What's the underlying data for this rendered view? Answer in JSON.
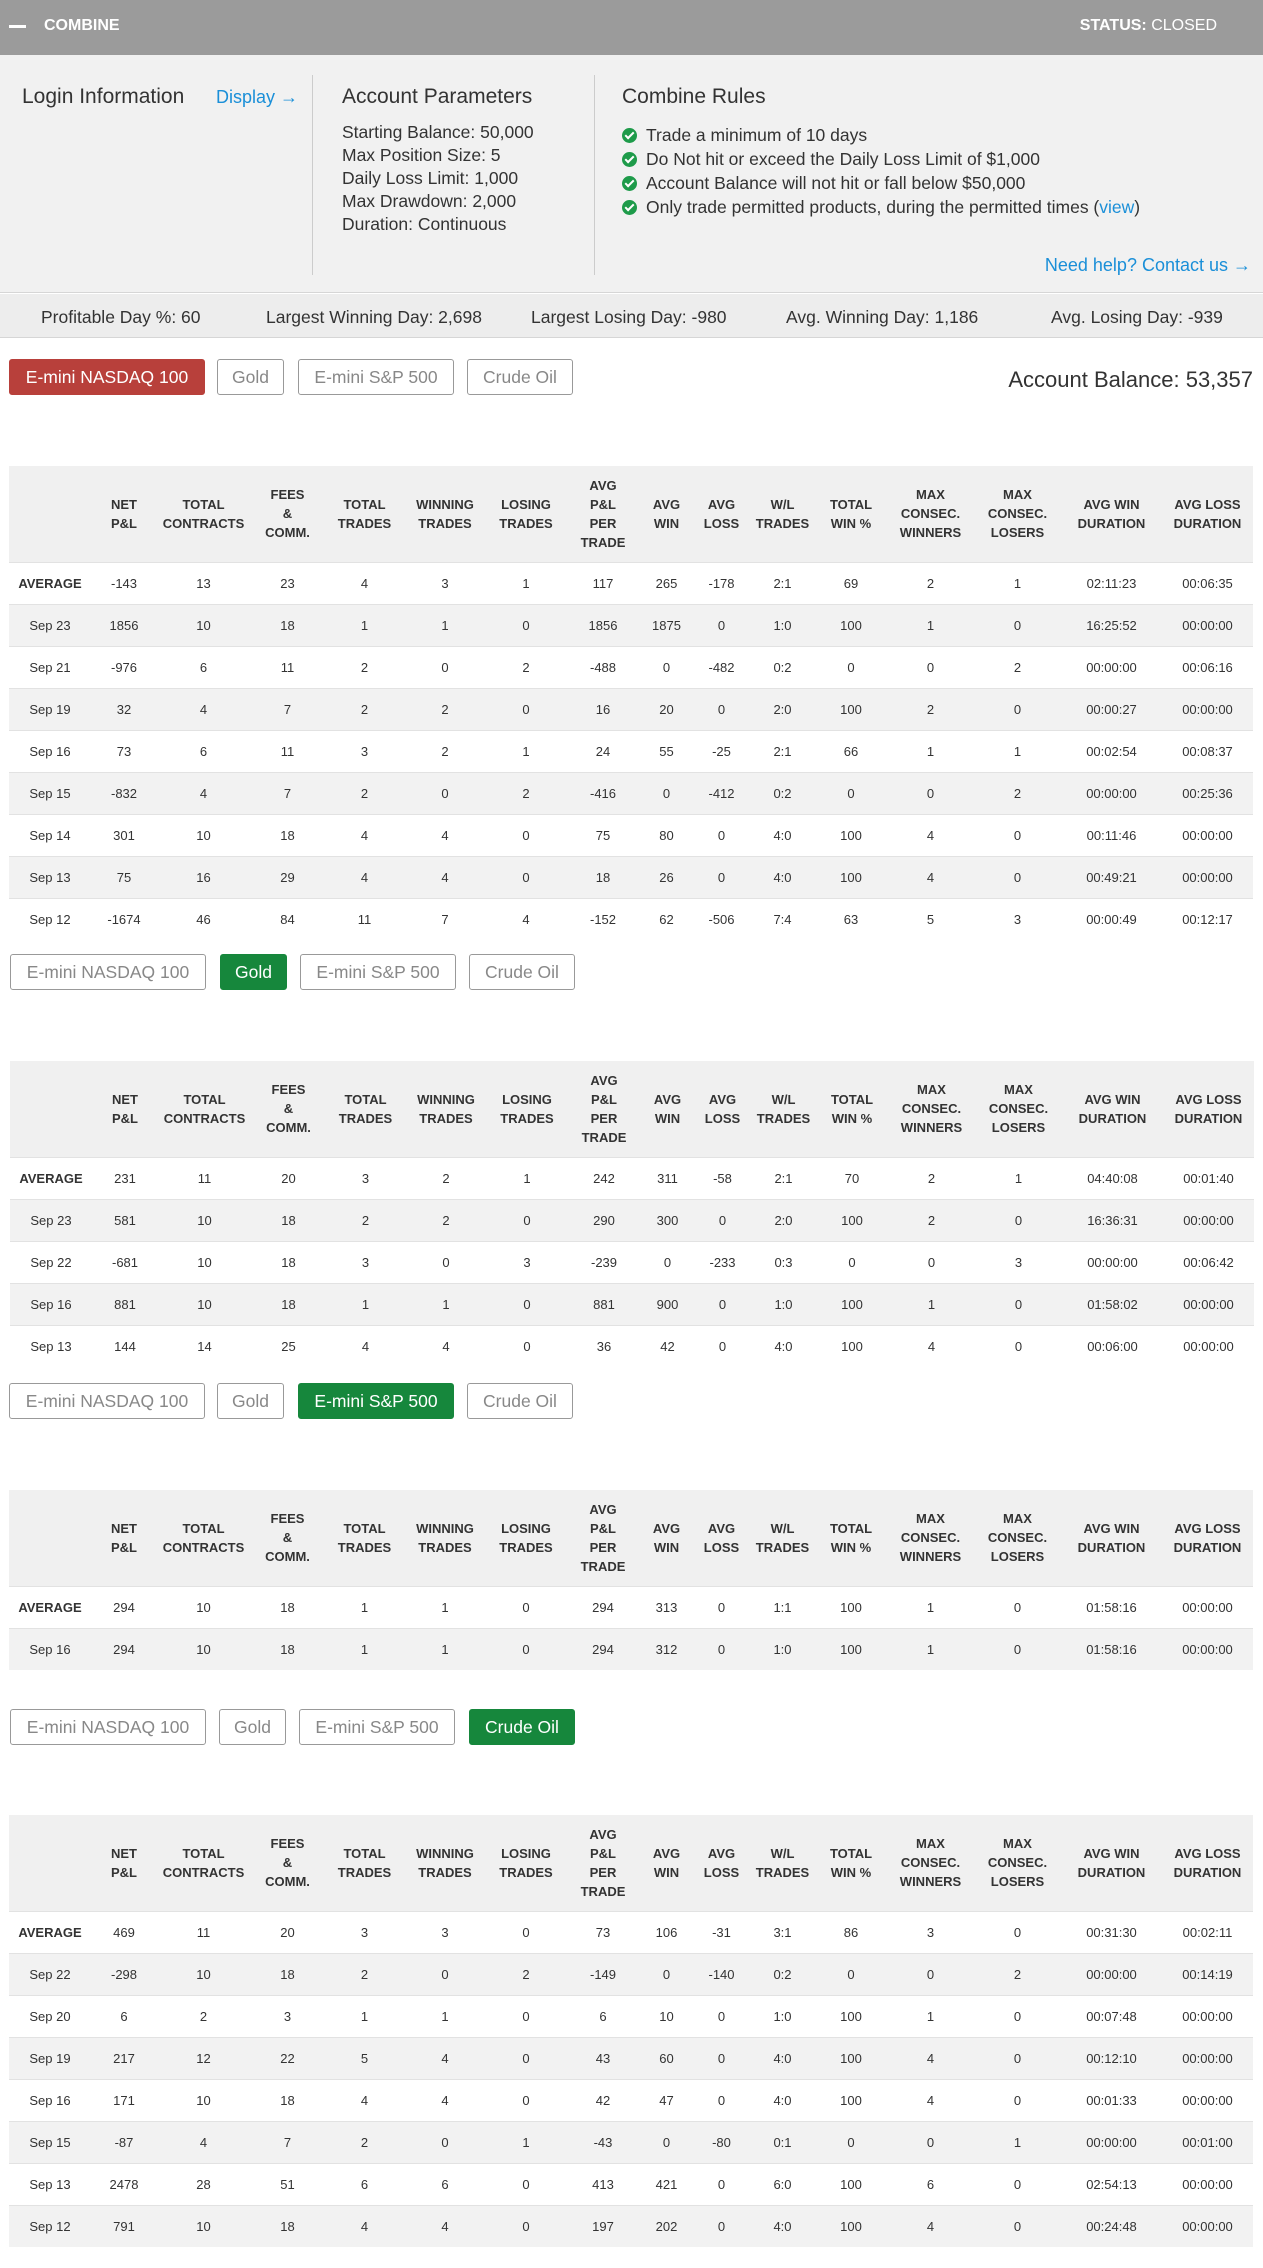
{
  "header": {
    "title": "COMBINE",
    "status_label": "STATUS:",
    "status_value": "CLOSED"
  },
  "login": {
    "title": "Login Information",
    "display_link": "Display →"
  },
  "params": {
    "title": "Account Parameters",
    "items": [
      "Starting Balance: 50,000",
      "Max Position Size: 5",
      "Daily Loss Limit: 1,000",
      "Max Drawdown: 2,000",
      "Duration: Continuous"
    ]
  },
  "rules": {
    "title": "Combine Rules",
    "items": [
      "Trade a minimum of 10 days",
      "Do Not hit or exceed the Daily Loss Limit of $1,000",
      "Account Balance will not hit or fall below $50,000",
      "Only trade permitted products, during the permitted times ("
    ],
    "view_link": "view",
    "close_paren": ")",
    "help_link": "Need help? Contact us →"
  },
  "stats": {
    "profitable": "Profitable Day %: 60",
    "largest_win": "Largest Winning Day: 2,698",
    "largest_loss": "Largest Losing Day: -980",
    "avg_win": "Avg. Winning Day: 1,186",
    "avg_loss": "Avg. Losing Day: -939"
  },
  "balance": "Account Balance: 53,357",
  "tab_labels": [
    "E-mini NASDAQ 100",
    "Gold",
    "E-mini S&P 500",
    "Crude Oil"
  ],
  "columns": [
    "",
    "NET P&L",
    "TOTAL CONTRACTS",
    "FEES & COMM.",
    "TOTAL TRADES",
    "WINNING TRADES",
    "LOSING TRADES",
    "AVG P&L PER TRADE",
    "AVG WIN",
    "AVG LOSS",
    "W/L TRADES",
    "TOTAL WIN %",
    "MAX CONSEC. WINNERS",
    "MAX CONSEC. LOSERS",
    "AVG WIN DURATION",
    "AVG LOSS DURATION"
  ],
  "tables": [
    {
      "product": "E-mini NASDAQ 100",
      "rows": [
        [
          "AVERAGE",
          "-143",
          "13",
          "23",
          "4",
          "3",
          "1",
          "117",
          "265",
          "-178",
          "2:1",
          "69",
          "2",
          "1",
          "02:11:23",
          "00:06:35"
        ],
        [
          "Sep 23",
          "1856",
          "10",
          "18",
          "1",
          "1",
          "0",
          "1856",
          "1875",
          "0",
          "1:0",
          "100",
          "1",
          "0",
          "16:25:52",
          "00:00:00"
        ],
        [
          "Sep 21",
          "-976",
          "6",
          "11",
          "2",
          "0",
          "2",
          "-488",
          "0",
          "-482",
          "0:2",
          "0",
          "0",
          "2",
          "00:00:00",
          "00:06:16"
        ],
        [
          "Sep 19",
          "32",
          "4",
          "7",
          "2",
          "2",
          "0",
          "16",
          "20",
          "0",
          "2:0",
          "100",
          "2",
          "0",
          "00:00:27",
          "00:00:00"
        ],
        [
          "Sep 16",
          "73",
          "6",
          "11",
          "3",
          "2",
          "1",
          "24",
          "55",
          "-25",
          "2:1",
          "66",
          "1",
          "1",
          "00:02:54",
          "00:08:37"
        ],
        [
          "Sep 15",
          "-832",
          "4",
          "7",
          "2",
          "0",
          "2",
          "-416",
          "0",
          "-412",
          "0:2",
          "0",
          "0",
          "2",
          "00:00:00",
          "00:25:36"
        ],
        [
          "Sep 14",
          "301",
          "10",
          "18",
          "4",
          "4",
          "0",
          "75",
          "80",
          "0",
          "4:0",
          "100",
          "4",
          "0",
          "00:11:46",
          "00:00:00"
        ],
        [
          "Sep 13",
          "75",
          "16",
          "29",
          "4",
          "4",
          "0",
          "18",
          "26",
          "0",
          "4:0",
          "100",
          "4",
          "0",
          "00:49:21",
          "00:00:00"
        ],
        [
          "Sep 12",
          "-1674",
          "46",
          "84",
          "11",
          "7",
          "4",
          "-152",
          "62",
          "-506",
          "7:4",
          "63",
          "5",
          "3",
          "00:00:49",
          "00:12:17"
        ]
      ]
    },
    {
      "product": "Gold",
      "rows": [
        [
          "AVERAGE",
          "231",
          "11",
          "20",
          "3",
          "2",
          "1",
          "242",
          "311",
          "-58",
          "2:1",
          "70",
          "2",
          "1",
          "04:40:08",
          "00:01:40"
        ],
        [
          "Sep 23",
          "581",
          "10",
          "18",
          "2",
          "2",
          "0",
          "290",
          "300",
          "0",
          "2:0",
          "100",
          "2",
          "0",
          "16:36:31",
          "00:00:00"
        ],
        [
          "Sep 22",
          "-681",
          "10",
          "18",
          "3",
          "0",
          "3",
          "-239",
          "0",
          "-233",
          "0:3",
          "0",
          "0",
          "3",
          "00:00:00",
          "00:06:42"
        ],
        [
          "Sep 16",
          "881",
          "10",
          "18",
          "1",
          "1",
          "0",
          "881",
          "900",
          "0",
          "1:0",
          "100",
          "1",
          "0",
          "01:58:02",
          "00:00:00"
        ],
        [
          "Sep 13",
          "144",
          "14",
          "25",
          "4",
          "4",
          "0",
          "36",
          "42",
          "0",
          "4:0",
          "100",
          "4",
          "0",
          "00:06:00",
          "00:00:00"
        ]
      ]
    },
    {
      "product": "E-mini S&P 500",
      "rows": [
        [
          "AVERAGE",
          "294",
          "10",
          "18",
          "1",
          "1",
          "0",
          "294",
          "313",
          "0",
          "1:1",
          "100",
          "1",
          "0",
          "01:58:16",
          "00:00:00"
        ],
        [
          "Sep 16",
          "294",
          "10",
          "18",
          "1",
          "1",
          "0",
          "294",
          "312",
          "0",
          "1:0",
          "100",
          "1",
          "0",
          "01:58:16",
          "00:00:00"
        ]
      ]
    },
    {
      "product": "Crude Oil",
      "rows": [
        [
          "AVERAGE",
          "469",
          "11",
          "20",
          "3",
          "3",
          "0",
          "73",
          "106",
          "-31",
          "3:1",
          "86",
          "3",
          "0",
          "00:31:30",
          "00:02:11"
        ],
        [
          "Sep 22",
          "-298",
          "10",
          "18",
          "2",
          "0",
          "2",
          "-149",
          "0",
          "-140",
          "0:2",
          "0",
          "0",
          "2",
          "00:00:00",
          "00:14:19"
        ],
        [
          "Sep 20",
          "6",
          "2",
          "3",
          "1",
          "1",
          "0",
          "6",
          "10",
          "0",
          "1:0",
          "100",
          "1",
          "0",
          "00:07:48",
          "00:00:00"
        ],
        [
          "Sep 19",
          "217",
          "12",
          "22",
          "5",
          "4",
          "0",
          "43",
          "60",
          "0",
          "4:0",
          "100",
          "4",
          "0",
          "00:12:10",
          "00:00:00"
        ],
        [
          "Sep 16",
          "171",
          "10",
          "18",
          "4",
          "4",
          "0",
          "42",
          "47",
          "0",
          "4:0",
          "100",
          "4",
          "0",
          "00:01:33",
          "00:00:00"
        ],
        [
          "Sep 15",
          "-87",
          "4",
          "7",
          "2",
          "0",
          "1",
          "-43",
          "0",
          "-80",
          "0:1",
          "0",
          "0",
          "1",
          "00:00:00",
          "00:01:00"
        ],
        [
          "Sep 13",
          "2478",
          "28",
          "51",
          "6",
          "6",
          "0",
          "413",
          "421",
          "0",
          "6:0",
          "100",
          "6",
          "0",
          "02:54:13",
          "00:00:00"
        ],
        [
          "Sep 12",
          "791",
          "10",
          "18",
          "4",
          "4",
          "0",
          "197",
          "202",
          "0",
          "4:0",
          "100",
          "4",
          "0",
          "00:24:48",
          "00:00:00"
        ]
      ]
    }
  ]
}
